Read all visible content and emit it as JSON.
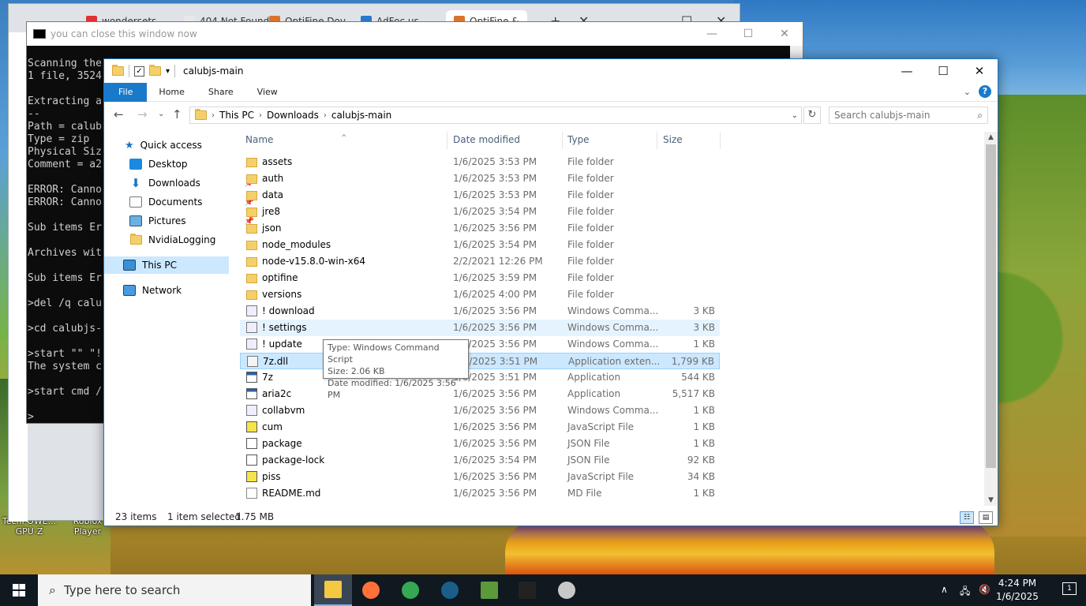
{
  "browser": {
    "tabs": [
      {
        "label": "wondersets",
        "color": "#e03131"
      },
      {
        "label": "404 Not Found",
        "color": "#e8e8e8"
      },
      {
        "label": "OptiFine Dov",
        "color": "#d9732c"
      },
      {
        "label": "AdFoc.us",
        "color": "#2a78c8"
      },
      {
        "label": "OptiFine &",
        "color": "#d9732c"
      }
    ]
  },
  "console": {
    "title": "you can close this window now",
    "lines": [
      "Scanning the",
      "1 file, 3524",
      "",
      "Extracting a",
      "--",
      "Path = calub",
      "Type = zip",
      "Physical Siz",
      "Comment = a2",
      "",
      "ERROR: Canno",
      "ERROR: Canno",
      "",
      "Sub items Er",
      "",
      "Archives wit",
      "",
      "Sub items Er",
      "",
      ">del /q calu",
      "",
      ">cd calubjs-",
      "",
      ">start \"\" \"!",
      "The system c",
      "",
      ">start cmd /",
      "",
      ">"
    ]
  },
  "explorer": {
    "title": "calubjs-main",
    "ribbon_tabs": [
      "File",
      "Home",
      "Share",
      "View"
    ],
    "breadcrumb": [
      "This PC",
      "Downloads",
      "calubjs-main"
    ],
    "search_placeholder": "Search calubjs-main",
    "nav": {
      "quick_access": "Quick access",
      "desktop": "Desktop",
      "downloads": "Downloads",
      "documents": "Documents",
      "pictures": "Pictures",
      "nvidia": "NvidiaLogging",
      "this_pc": "This PC",
      "network": "Network"
    },
    "columns": {
      "name": "Name",
      "date": "Date modified",
      "type": "Type",
      "size": "Size"
    },
    "files": [
      {
        "name": "assets",
        "date": "1/6/2025 3:53 PM",
        "type": "File folder",
        "size": "",
        "icon": "folder"
      },
      {
        "name": "auth",
        "date": "1/6/2025 3:53 PM",
        "type": "File folder",
        "size": "",
        "icon": "folder"
      },
      {
        "name": "data",
        "date": "1/6/2025 3:53 PM",
        "type": "File folder",
        "size": "",
        "icon": "folder"
      },
      {
        "name": "jre8",
        "date": "1/6/2025 3:54 PM",
        "type": "File folder",
        "size": "",
        "icon": "folder"
      },
      {
        "name": "json",
        "date": "1/6/2025 3:56 PM",
        "type": "File folder",
        "size": "",
        "icon": "folder"
      },
      {
        "name": "node_modules",
        "date": "1/6/2025 3:54 PM",
        "type": "File folder",
        "size": "",
        "icon": "folder"
      },
      {
        "name": "node-v15.8.0-win-x64",
        "date": "2/2/2021 12:26 PM",
        "type": "File folder",
        "size": "",
        "icon": "folder"
      },
      {
        "name": "optifine",
        "date": "1/6/2025 3:59 PM",
        "type": "File folder",
        "size": "",
        "icon": "folder"
      },
      {
        "name": "versions",
        "date": "1/6/2025 4:00 PM",
        "type": "File folder",
        "size": "",
        "icon": "folder"
      },
      {
        "name": "! download",
        "date": "1/6/2025 3:56 PM",
        "type": "Windows Comma...",
        "size": "3 KB",
        "icon": "cmd"
      },
      {
        "name": "! settings",
        "date": "1/6/2025 3:56 PM",
        "type": "Windows Comma...",
        "size": "3 KB",
        "icon": "cmd",
        "state": "hover"
      },
      {
        "name": "! update",
        "date": "1/6/2025 3:56 PM",
        "type": "Windows Comma...",
        "size": "1 KB",
        "icon": "cmd"
      },
      {
        "name": "7z.dll",
        "date": "1/6/2025 3:51 PM",
        "type": "Application exten...",
        "size": "1,799 KB",
        "icon": "dll",
        "state": "sel"
      },
      {
        "name": "7z",
        "date": "1/6/2025 3:51 PM",
        "type": "Application",
        "size": "544 KB",
        "icon": "app"
      },
      {
        "name": "aria2c",
        "date": "1/6/2025 3:56 PM",
        "type": "Application",
        "size": "5,517 KB",
        "icon": "app"
      },
      {
        "name": "collabvm",
        "date": "1/6/2025 3:56 PM",
        "type": "Windows Comma...",
        "size": "1 KB",
        "icon": "cmd"
      },
      {
        "name": "cum",
        "date": "1/6/2025 3:56 PM",
        "type": "JavaScript File",
        "size": "1 KB",
        "icon": "js"
      },
      {
        "name": "package",
        "date": "1/6/2025 3:56 PM",
        "type": "JSON File",
        "size": "1 KB",
        "icon": "json"
      },
      {
        "name": "package-lock",
        "date": "1/6/2025 3:54 PM",
        "type": "JSON File",
        "size": "92 KB",
        "icon": "json"
      },
      {
        "name": "piss",
        "date": "1/6/2025 3:56 PM",
        "type": "JavaScript File",
        "size": "34 KB",
        "icon": "js"
      },
      {
        "name": "README.md",
        "date": "1/6/2025 3:56 PM",
        "type": "MD File",
        "size": "1 KB",
        "icon": "md"
      }
    ],
    "status": {
      "items": "23 items",
      "selected": "1 item selected",
      "size": "1.75 MB"
    },
    "tooltip": [
      "Type: Windows Command Script",
      "Size: 2.06 KB",
      "Date modified: 1/6/2025 3:56 PM"
    ]
  },
  "desktop_icons": [
    {
      "label1": "TechPOWE...",
      "label2": "GPU-Z"
    },
    {
      "label1": "Roblox",
      "label2": "Player"
    }
  ],
  "taskbar": {
    "search_placeholder": "Type here to search",
    "time": "4:24 PM",
    "date": "1/6/2025",
    "notification_count": "1",
    "apps": [
      {
        "name": "file-explorer",
        "color": "#f5c842"
      },
      {
        "name": "firefox",
        "color": "#ff7139"
      },
      {
        "name": "chrome",
        "color": "#34a853"
      },
      {
        "name": "steam",
        "color": "#1b5e8a"
      },
      {
        "name": "minecraft-launcher",
        "color": "#5a9a3a"
      },
      {
        "name": "command-prompt",
        "color": "#222222"
      },
      {
        "name": "unity-app",
        "color": "#c8c8c8"
      }
    ]
  }
}
